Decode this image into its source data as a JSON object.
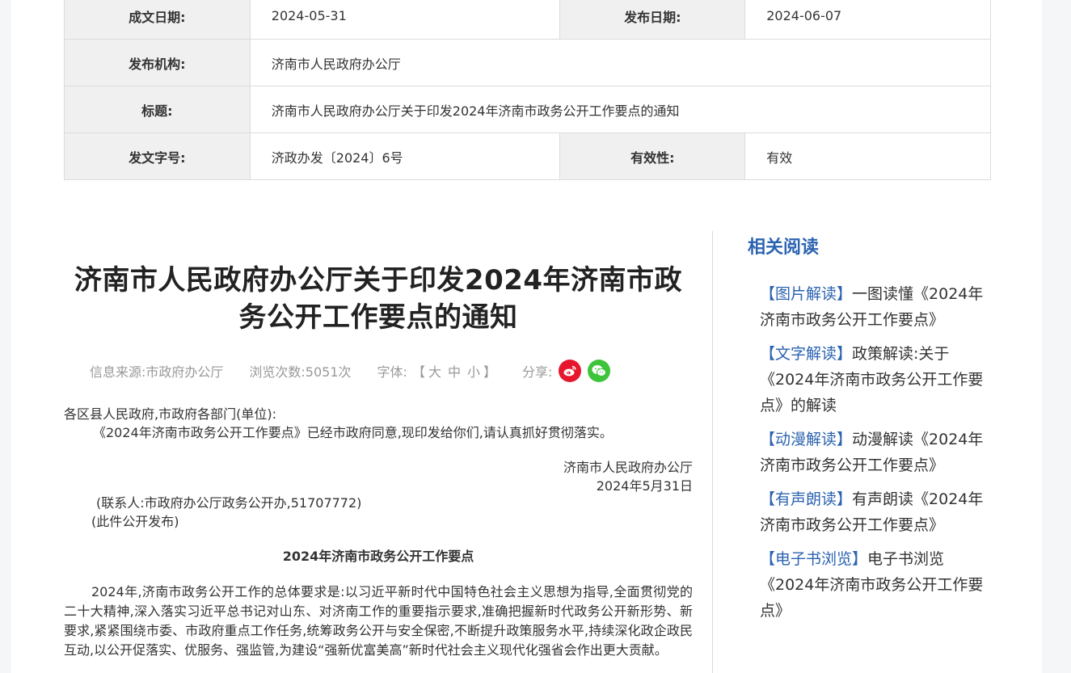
{
  "info": {
    "date_written_label": "成文日期:",
    "date_written": "2024-05-31",
    "date_published_label": "发布日期:",
    "date_published": "2024-06-07",
    "agency_label": "发布机构:",
    "agency": "济南市人民政府办公厅",
    "title_label": "标题:",
    "title": "济南市人民政府办公厅关于印发2024年济南市政务公开工作要点的通知",
    "doc_no_label": "发文字号:",
    "doc_no": "济政办发〔2024〕6号",
    "validity_label": "有效性:",
    "validity": "有效"
  },
  "article": {
    "title": "济南市人民政府办公厅关于印发2024年济南市政务公开工作要点的通知",
    "source": "信息来源:市政府办公厅",
    "views": "浏览次数:5051次",
    "font_label": "字体:",
    "font_bracket_open": "【",
    "font_large": "大",
    "font_medium": "中",
    "font_small": "小",
    "font_bracket_close": "】",
    "share_label": "分享:",
    "salutation": "各区县人民政府,市政府各部门(单位):",
    "para1": "《2024年济南市政务公开工作要点》已经市政府同意,现印发给你们,请认真抓好贯彻落实。",
    "signature_org": "济南市人民政府办公厅",
    "signature_date": "2024年5月31日",
    "contact": "(联系人:市政府办公厅政务公开办,51707772)",
    "public_note": "(此件公开发布)",
    "subtitle": "2024年济南市政务公开工作要点",
    "para2": "2024年,济南市政务公开工作的总体要求是:以习近平新时代中国特色社会主义思想为指导,全面贯彻党的二十大精神,深入落实习近平总书记对山东、对济南工作的重要指示要求,准确把握新时代政务公开新形势、新要求,紧紧围绕市委、市政府重点工作任务,统筹政务公开与安全保密,不断提升政策服务水平,持续深化政企政民互动,以公开促落实、优服务、强监管,为建设“强新优富美高”新时代社会主义现代化强省会作出更大贡献。"
  },
  "related": {
    "heading": "相关阅读",
    "items": [
      {
        "tag": "【图片解读】",
        "text": "一图读懂《2024年济南市政务公开工作要点》"
      },
      {
        "tag": "【文字解读】",
        "text": "政策解读:关于《2024年济南市政务公开工作要点》的解读"
      },
      {
        "tag": "【动漫解读】",
        "text": "动漫解读《2024年济南市政务公开工作要点》"
      },
      {
        "tag": "【有声朗读】",
        "text": "有声朗读《2024年济南市政务公开工作要点》"
      },
      {
        "tag": "【电子书浏览】",
        "text": "电子书浏览《2024年济南市政务公开工作要点》"
      }
    ]
  },
  "colors": {
    "accent": "#2b63b0",
    "weibo": "#e6162d",
    "wechat": "#3ec43a"
  },
  "icons": {
    "share1": "weibo-icon",
    "share2": "wechat-icon"
  }
}
